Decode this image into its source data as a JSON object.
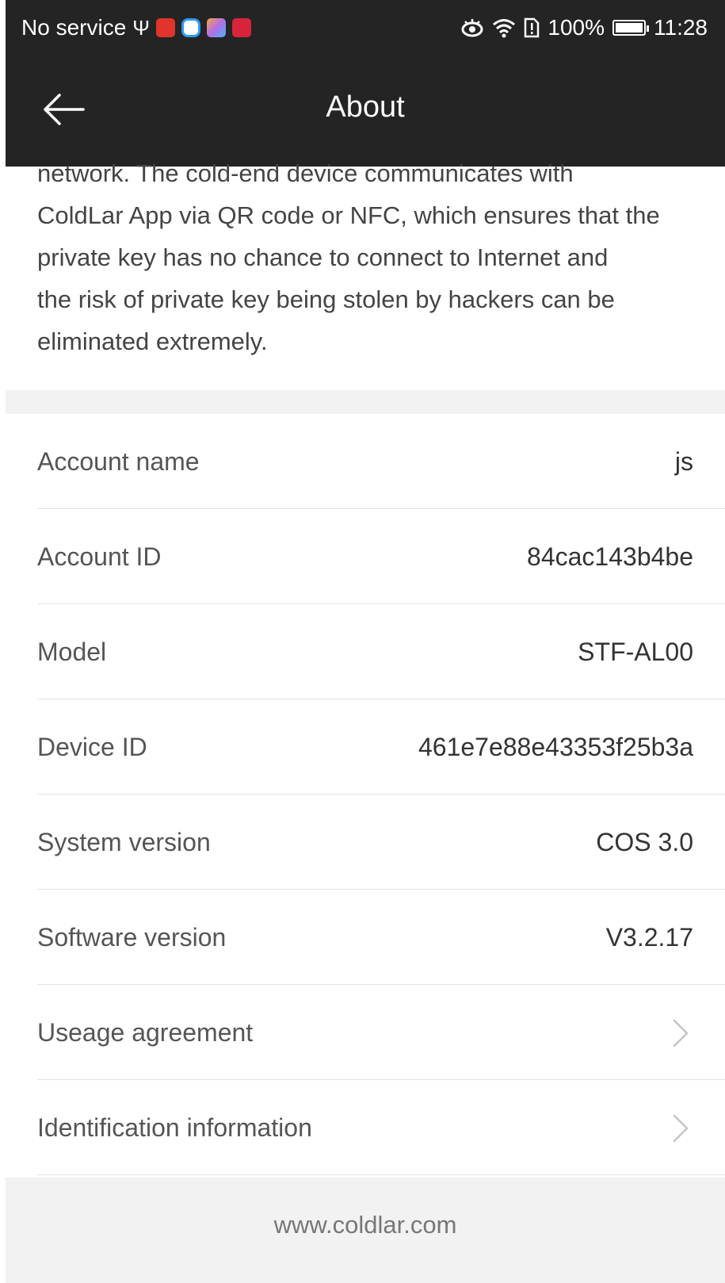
{
  "status_bar": {
    "carrier": "No service",
    "battery": "100%",
    "time": "11:28",
    "icons": [
      "usb-icon",
      "toutiao-app-icon",
      "browser-app-icon",
      "gallery-app-icon",
      "huawei-app-icon",
      "eye-comfort-icon",
      "wifi-icon",
      "sim-alert-icon",
      "battery-icon"
    ]
  },
  "app_bar": {
    "title": "About",
    "back_icon": "arrow-left-icon"
  },
  "intro": {
    "lines": [
      "network. The cold-end device communicates with",
      "ColdLar App via QR code or NFC, which ensures that the",
      "private key has no chance to connect to Internet and",
      "the risk of private key being stolen by hackers can be",
      "eliminated extremely."
    ]
  },
  "info": {
    "account_name": {
      "label": "Account name",
      "value": "js"
    },
    "account_id": {
      "label": "Account ID",
      "value": "84cac143b4be"
    },
    "model": {
      "label": "Model",
      "value": "STF-AL00"
    },
    "device_id": {
      "label": "Device ID",
      "value": "461e7e88e43353f25b3a"
    },
    "system_version": {
      "label": "System version",
      "value": "COS 3.0"
    },
    "software_version": {
      "label": "Software version",
      "value": "V3.2.17"
    }
  },
  "links": {
    "usage_agreement": {
      "label": "Useage agreement"
    },
    "identification": {
      "label": "Identification information"
    }
  },
  "footer": {
    "website": "www.coldlar.com"
  },
  "colors": {
    "header_bg": "#242424",
    "band_bg": "#f2f2f2",
    "divider": "#e3e3e3"
  }
}
